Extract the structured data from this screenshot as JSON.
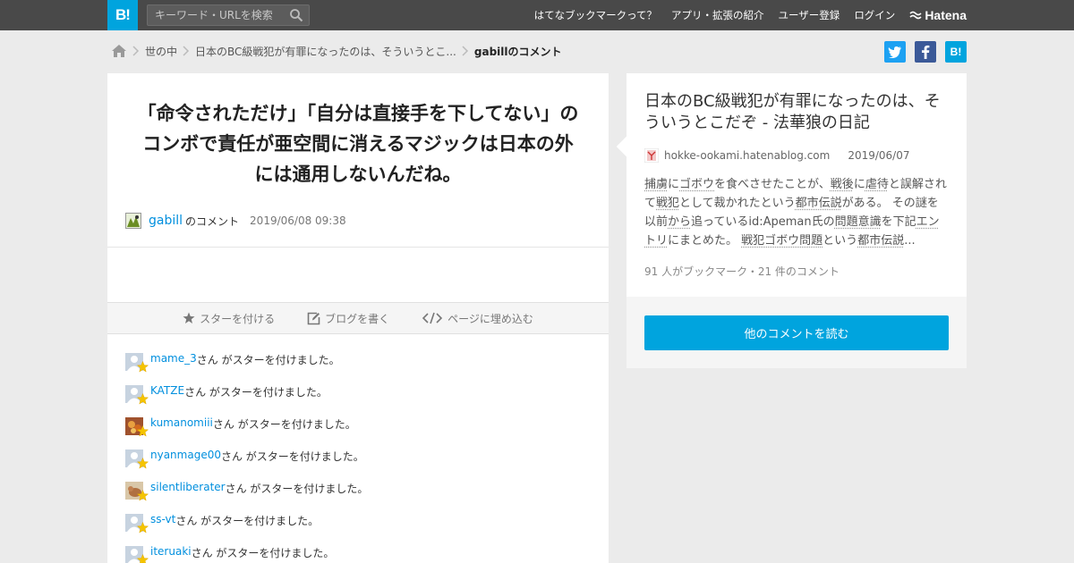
{
  "header": {
    "logo_text": "B!",
    "search_placeholder": "キーワード・URLを検索",
    "nav": [
      "はてなブックマークって？",
      "アプリ・拡張の紹介",
      "ユーザー登録",
      "ログイン"
    ],
    "brand": "Hatena"
  },
  "breadcrumb": {
    "items": [
      "世の中",
      "日本のBC級戦犯が有罪になったのは、そういうとこ...",
      "gabillのコメント"
    ]
  },
  "share": {
    "twitter": "t",
    "facebook": "f",
    "hatena": "B!"
  },
  "comment": {
    "text": "「命令されただけ」「自分は直接手を下してない」のコンボで責任が亜空間に消えるマジックは日本の外には通用しないんだね。",
    "user": "gabill",
    "user_suffix": "のコメント",
    "date": "2019/06/08 09:38"
  },
  "actions": {
    "star": "スターを付ける",
    "blog": "ブログを書く",
    "embed": "ページに埋め込む"
  },
  "stars": {
    "suffix": "さん がスターを付けました。",
    "users": [
      "mame_3",
      "KATZE",
      "kumanomiii",
      "nyanmage00",
      "silentliberater",
      "ss-vt",
      "iteruaki"
    ]
  },
  "entry": {
    "title": "日本のBC級戦犯が有罪になったのは、そういうとこだぞ - 法華狼の日記",
    "domain": "hokke-ookami.hatenablog.com",
    "date": "2019/06/07",
    "summary": [
      {
        "t": "捕虜",
        "k": true
      },
      {
        "t": "に",
        "k": false
      },
      {
        "t": "ゴボウ",
        "k": true
      },
      {
        "t": "を食べさせたことが、",
        "k": false
      },
      {
        "t": "戦後",
        "k": true
      },
      {
        "t": "に",
        "k": false
      },
      {
        "t": "虐待",
        "k": true
      },
      {
        "t": "と誤解されて",
        "k": false
      },
      {
        "t": "戦犯",
        "k": true
      },
      {
        "t": "として裁かれたという",
        "k": false
      },
      {
        "t": "都市伝説",
        "k": true
      },
      {
        "t": "がある。 その謎を以前",
        "k": false
      },
      {
        "t": "から",
        "k": true
      },
      {
        "t": "追っているid:Apeman氏の",
        "k": false
      },
      {
        "t": "問題意識",
        "k": true
      },
      {
        "t": "を下記",
        "k": false
      },
      {
        "t": "エントリ",
        "k": true
      },
      {
        "t": "にまとめた。 ",
        "k": false
      },
      {
        "t": "戦犯ゴボウ問題",
        "k": true
      },
      {
        "t": "という",
        "k": false
      },
      {
        "t": "都市伝説",
        "k": true
      },
      {
        "t": "...",
        "k": false
      }
    ],
    "count": "91 人がブックマーク・21 件のコメント",
    "read_button": "他のコメントを読む"
  },
  "colors": {
    "accent": "#00a4de",
    "link": "#008fde",
    "star": "#f5c400",
    "topbar": "#494949"
  }
}
